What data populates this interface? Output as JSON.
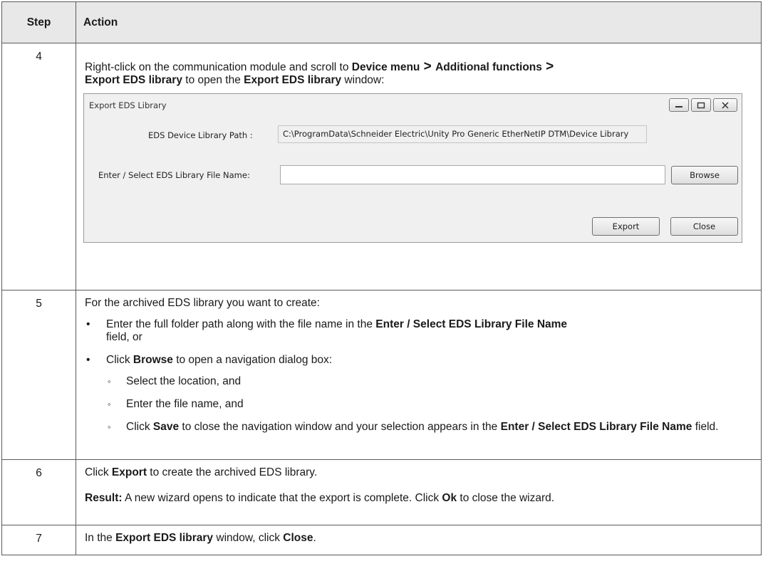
{
  "table": {
    "header": {
      "step": "Step",
      "action": "Action"
    },
    "rows": {
      "r4": {
        "step": "4",
        "p1": "Right-click on the communication module and scroll to ",
        "b1": "Device menu",
        "gt1": " > ",
        "b2": "Additional functions",
        "gt2": " > ",
        "b3": "Export EDS library",
        "p2": " to open the ",
        "b4": "Export EDS library",
        "p3": " window:"
      },
      "r5": {
        "step": "5",
        "intro": "For the archived EDS library you want to create:",
        "bullet1": {
          "t1": "Enter the full folder path along with the file name in the ",
          "b1": "Enter / Select EDS Library File Name",
          "t2": " field, or"
        },
        "bullet2": {
          "t1": "Click ",
          "b1": "Browse",
          "t2": " to open a navigation dialog box:"
        },
        "sub1": "Select the location, and",
        "sub2": "Enter the file name, and",
        "sub3": {
          "t1": "Click ",
          "b1": "Save",
          "t2": " to close the navigation window and your selection appears in the ",
          "b2": "Enter / Select EDS Library File Name",
          "t3": " field."
        }
      },
      "r6": {
        "step": "6",
        "t1": "Click ",
        "b1": "Export",
        "t2": " to create the archived EDS library.",
        "result_label": "Result:",
        "r_t1": " A new wizard opens to indicate that the export is complete. Click ",
        "r_b1": "Ok",
        "r_t2": " to close the wizard."
      },
      "r7": {
        "step": "7",
        "t1": "In the ",
        "b1": "Export EDS library",
        "t2": " window, click ",
        "b2": "Close",
        "t3": "."
      }
    }
  },
  "dialog": {
    "title": "Export EDS Library",
    "path_label": "EDS Device Library Path :",
    "path_value": "C:\\ProgramData\\Schneider Electric\\Unity Pro Generic EtherNetIP DTM\\Device Library",
    "file_label": "Enter / Select EDS Library File Name:",
    "file_value": "",
    "browse": "Browse",
    "export": "Export",
    "close": "Close",
    "icons": {
      "minimize": "minimize-icon",
      "maximize": "maximize-icon",
      "close": "close-icon"
    }
  }
}
